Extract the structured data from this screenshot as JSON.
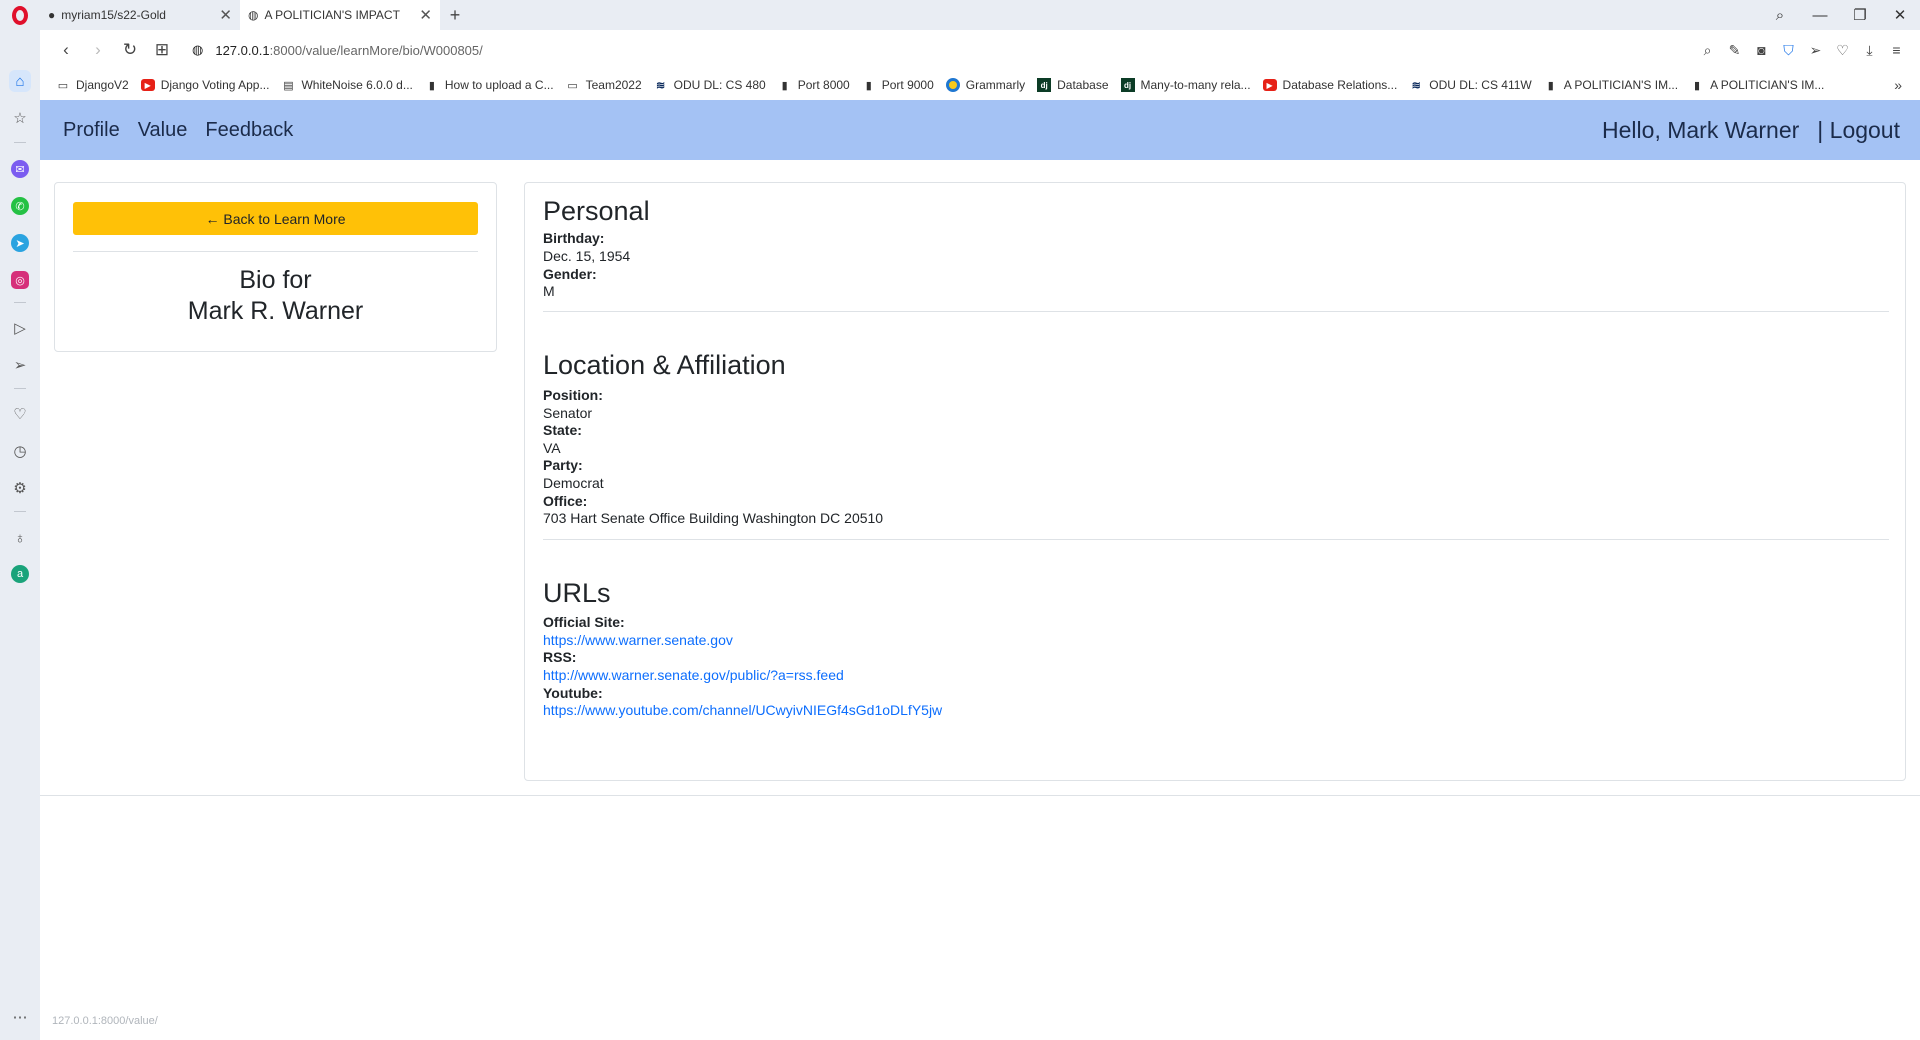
{
  "browser": {
    "tabs": [
      {
        "label": "myriam15/s22-Gold",
        "icon": "github-icon",
        "active": false
      },
      {
        "label": "A POLITICIAN'S IMPACT",
        "icon": "globe-icon",
        "active": true
      }
    ],
    "new_tab": "+",
    "controls": {
      "search": "⌕",
      "minimize": "—",
      "restore": "❐",
      "close": "✕"
    },
    "address": {
      "host": "127.0.0.1",
      "path": ":8000/value/learnMore/bio/W000805/"
    },
    "bookmarks": [
      {
        "label": "DjangoV2",
        "icon": "folder-icon"
      },
      {
        "label": "Django Voting App...",
        "icon": "youtube-icon"
      },
      {
        "label": "WhiteNoise 6.0.0 d...",
        "icon": "doc-icon"
      },
      {
        "label": "How to upload a C...",
        "icon": "file-icon"
      },
      {
        "label": "Team2022",
        "icon": "folder-icon"
      },
      {
        "label": "ODU DL: CS 480",
        "icon": "odu-icon"
      },
      {
        "label": "Port 8000",
        "icon": "file-icon"
      },
      {
        "label": "Port 9000",
        "icon": "file-icon"
      },
      {
        "label": "Grammarly",
        "icon": "grammarly-icon"
      },
      {
        "label": "Database",
        "icon": "django-icon"
      },
      {
        "label": "Many-to-many rela...",
        "icon": "django-icon"
      },
      {
        "label": "Database Relations...",
        "icon": "youtube-icon"
      },
      {
        "label": "ODU DL: CS 411W",
        "icon": "odu-icon"
      },
      {
        "label": "A POLITICIAN'S IM...",
        "icon": "file-icon"
      },
      {
        "label": "A POLITICIAN'S IM...",
        "icon": "file-icon"
      }
    ],
    "bookmarks_more": "»",
    "status_url": "127.0.0.1:8000/value/"
  },
  "navbar": {
    "links": [
      "Profile",
      "Value",
      "Feedback"
    ],
    "greeting": "Hello, Mark Warner",
    "logout": "| Logout"
  },
  "left": {
    "back_button": "← Back to Learn More",
    "bio_line1": "Bio for",
    "bio_line2": "Mark R. Warner"
  },
  "personal": {
    "title": "Personal",
    "birthday_label": "Birthday:",
    "birthday": "Dec. 15, 1954",
    "gender_label": "Gender:",
    "gender": "M"
  },
  "location": {
    "title": "Location & Affiliation",
    "position_label": "Position:",
    "position": "Senator",
    "state_label": "State:",
    "state": "VA",
    "party_label": "Party:",
    "party": "Democrat",
    "office_label": "Office:",
    "office": "703 Hart Senate Office Building Washington DC 20510"
  },
  "urls": {
    "title": "URLs",
    "official_label": "Official Site:",
    "official": "https://www.warner.senate.gov",
    "rss_label": "RSS:",
    "rss": "http://www.warner.senate.gov/public/?a=rss.feed",
    "youtube_label": "Youtube:",
    "youtube": "https://www.youtube.com/channel/UCwyivNIEGf4sGd1oDLfY5jw"
  }
}
